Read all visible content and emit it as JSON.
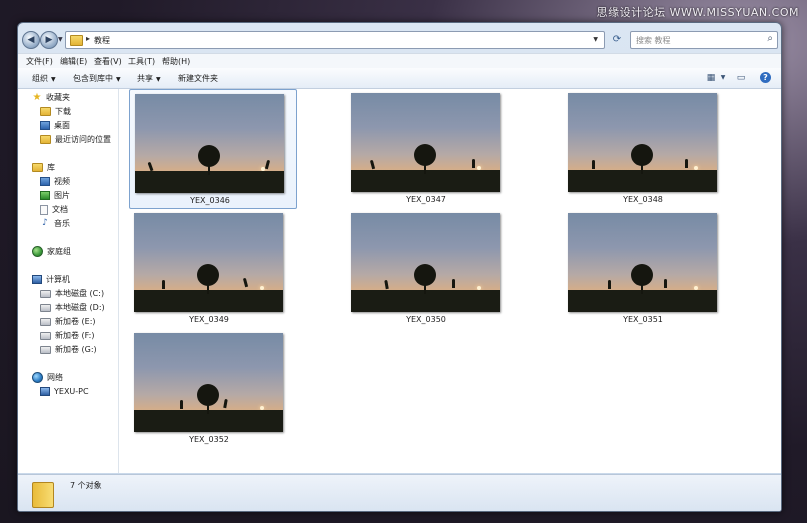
{
  "watermark": "思缘设计论坛 WWW.MISSYUAN.COM",
  "address": {
    "path": "教程",
    "separator": "▸"
  },
  "search": {
    "placeholder": "搜索 教程"
  },
  "menu": [
    "文件(F)",
    "编辑(E)",
    "查看(V)",
    "工具(T)",
    "帮助(H)"
  ],
  "toolbar": {
    "organize": "组织",
    "include_in_library": "包含到库中",
    "share": "共享",
    "new_folder": "新建文件夹"
  },
  "sidebar": {
    "favorites": {
      "label": "收藏夹",
      "items": [
        "下载",
        "桌面",
        "最近访问的位置"
      ]
    },
    "libraries": {
      "label": "库",
      "items": [
        "视频",
        "图片",
        "文档",
        "音乐"
      ]
    },
    "homegroup": "家庭组",
    "computer": {
      "label": "计算机",
      "items": [
        "本地磁盘 (C:)",
        "本地磁盘 (D:)",
        "新加卷 (E:)",
        "新加卷 (F:)",
        "新加卷 (G:)"
      ]
    },
    "network": {
      "label": "网络",
      "items": [
        "YEXU-PC"
      ]
    }
  },
  "files": [
    {
      "name": "YEX_0346",
      "selected": true
    },
    {
      "name": "YEX_0347",
      "selected": false
    },
    {
      "name": "YEX_0348",
      "selected": false
    },
    {
      "name": "YEX_0349",
      "selected": false
    },
    {
      "name": "YEX_0350",
      "selected": false
    },
    {
      "name": "YEX_0351",
      "selected": false
    },
    {
      "name": "YEX_0352",
      "selected": false
    }
  ],
  "status": {
    "item_count": "7 个对象"
  },
  "colors": {
    "accent": "#2f6cc0",
    "selection_border": "#7da2ce",
    "folder": "#e9bb3a"
  }
}
